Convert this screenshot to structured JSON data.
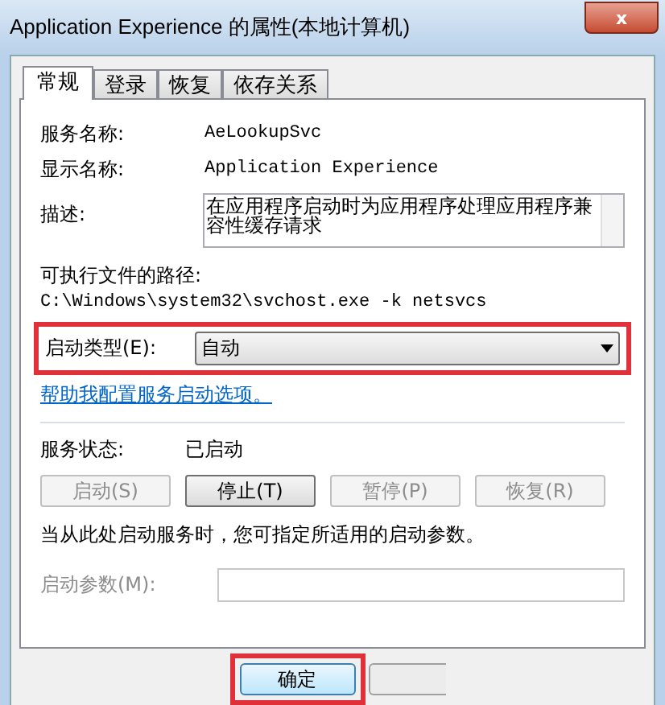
{
  "window": {
    "title": "Application Experience 的属性(本地计算机)",
    "close": "x"
  },
  "tabs": [
    {
      "label": "常规",
      "selected": true
    },
    {
      "label": "登录",
      "selected": false
    },
    {
      "label": "恢复",
      "selected": false
    },
    {
      "label": "依存关系",
      "selected": false
    }
  ],
  "fields": [
    {
      "label": "服务名称:",
      "value": "AeLookupSvc"
    },
    {
      "label": "显示名称:",
      "value": "Application Experience"
    }
  ],
  "description": {
    "label": "描述:",
    "value": "在应用程序启动时为应用程序处理应用程序兼容性缓存请求"
  },
  "path": {
    "label": "可执行文件的路径:",
    "value": "C:\\Windows\\system32\\svchost.exe -k netsvcs"
  },
  "startup_type": {
    "label": "启动类型(E):",
    "value": "自动",
    "highlighted": true
  },
  "help_link": "帮助我配置服务启动选项。",
  "status": {
    "label": "服务状态:",
    "value": "已启动"
  },
  "service_buttons": [
    {
      "label": "启动(S)",
      "disabled": true
    },
    {
      "label": "停止(T)",
      "disabled": false
    },
    {
      "label": "暂停(P)",
      "disabled": true
    },
    {
      "label": "恢复(R)",
      "disabled": true
    }
  ],
  "note": "当从此处启动服务时，您可指定所适用的启动参数。",
  "parameters": {
    "label": "启动参数(M):",
    "disabled": true
  },
  "footer_buttons": [
    {
      "label": "确定",
      "highlighted": true
    }
  ]
}
